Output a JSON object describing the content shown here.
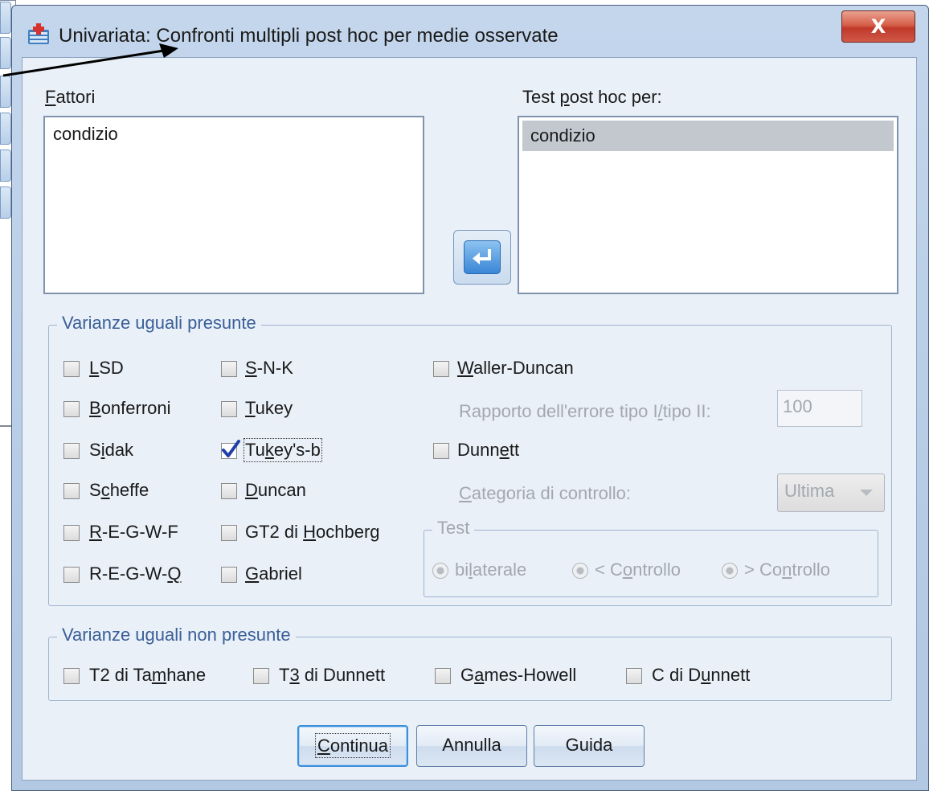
{
  "window": {
    "title": "Univariata: Confronti multipli post hoc per medie osservate",
    "close_symbol": "X"
  },
  "factors": {
    "label_accel": "F",
    "label_rest": "attori",
    "items": [
      "condizio"
    ]
  },
  "posthoc": {
    "label_pre": "Test ",
    "label_accel": "p",
    "label_rest": "ost hoc per:",
    "items": [
      "condizio"
    ]
  },
  "equal_variances": {
    "title": "Varianze uguali presunte",
    "lsd": {
      "a": "L",
      "b": "SD"
    },
    "snk": {
      "a": "S",
      "b": "-N-K"
    },
    "waller": {
      "a": "W",
      "b": "aller-Duncan"
    },
    "bonferroni": {
      "a": "B",
      "b": "onferroni"
    },
    "tukey": {
      "a": "T",
      "b": "ukey"
    },
    "ratio_label": {
      "a": "Rapporto dell'errore tipo I",
      "u": "/",
      "b": "tipo II:"
    },
    "ratio_value": "100",
    "sidak": {
      "a": "S",
      "u": "i",
      "b": "dak"
    },
    "tukeyb": {
      "a": "Tu",
      "u": "k",
      "b": "ey's-b",
      "checked": true
    },
    "dunnett": {
      "a": "Dunn",
      "u": "e",
      "b": "tt"
    },
    "scheffe": {
      "a": "S",
      "u": "c",
      "b": "heffe"
    },
    "duncan": {
      "a": "D",
      "b": "uncan"
    },
    "control_label": {
      "a": "C",
      "b": "ategoria di controllo:"
    },
    "control_value": "Ultima",
    "regwf": {
      "a": "R",
      "b": "-E-G-W-F"
    },
    "hochberg": {
      "a": "GT2 di ",
      "u": "H",
      "b": "ochberg"
    },
    "test_group_title": "Test",
    "twosided": {
      "a": "bi",
      "u": "l",
      "b": "aterale"
    },
    "less_control": {
      "a": "< C",
      "u": "o",
      "b": "ntrollo"
    },
    "greater_control": {
      "a": "> Co",
      "u": "n",
      "b": "trollo"
    },
    "regwq": {
      "a": "R-E-G-W-",
      "u": "Q",
      "b": ""
    },
    "gabriel": {
      "a": "G",
      "b": "abriel"
    }
  },
  "unequal_variances": {
    "title": "Varianze uguali non presunte",
    "tamhane": {
      "a": "T2 di Ta",
      "u": "m",
      "b": "hane"
    },
    "dunnett_t3": {
      "a": "T",
      "u": "3",
      "b": " di Dunnett"
    },
    "games_howell": {
      "a": "G",
      "u": "a",
      "b": "mes-Howell"
    },
    "dunnett_c": {
      "a": "C di D",
      "u": "u",
      "b": "nnett"
    }
  },
  "buttons": {
    "continue": {
      "a": "C",
      "b": "ontinua"
    },
    "cancel": "Annulla",
    "help": "Guida"
  },
  "colors": {
    "accent": "#3b5f98",
    "close_red": "#c0392b",
    "dialog_bg": "#e9f0f8"
  }
}
